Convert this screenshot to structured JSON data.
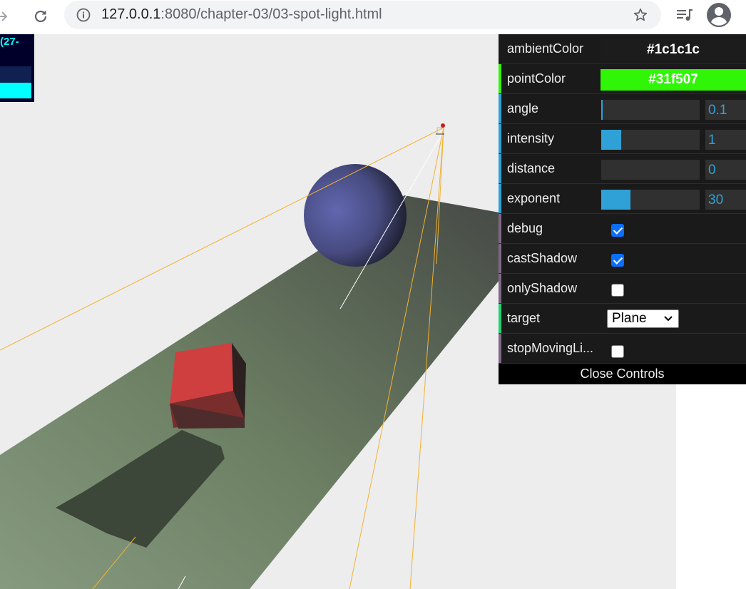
{
  "browser": {
    "url_host": "127.0.0.1",
    "url_rest": ":8080/chapter-03/03-spot-light.html"
  },
  "stats": {
    "text": "(27-"
  },
  "gui": {
    "ambient": {
      "label": "ambientColor",
      "value": "#1c1c1c",
      "color": "#1c1c1c"
    },
    "point": {
      "label": "pointColor",
      "value": "#31f507",
      "color": "#31f507"
    },
    "angle": {
      "label": "angle",
      "value": "0.1",
      "fill_fraction": 0.01
    },
    "intensity": {
      "label": "intensity",
      "value": "1",
      "fill_fraction": 0.2
    },
    "distance": {
      "label": "distance",
      "value": "0",
      "fill_fraction": 0
    },
    "exponent": {
      "label": "exponent",
      "value": "30",
      "fill_fraction": 0.3
    },
    "debug": {
      "label": "debug",
      "checked": true
    },
    "castShadow": {
      "label": "castShadow",
      "checked": true
    },
    "onlyShadow": {
      "label": "onlyShadow",
      "checked": false
    },
    "target": {
      "label": "target",
      "value": "Plane"
    },
    "stopMoving": {
      "label": "stopMovingLi...",
      "checked": false
    },
    "close_label": "Close Controls"
  },
  "colors": {
    "slider_blue": "#2fa1d6",
    "stripe_color": "#e61d5f",
    "stripe_number": "#2fa1d6",
    "stripe_bool": "#806787",
    "stripe_option": "#1ed36f"
  }
}
